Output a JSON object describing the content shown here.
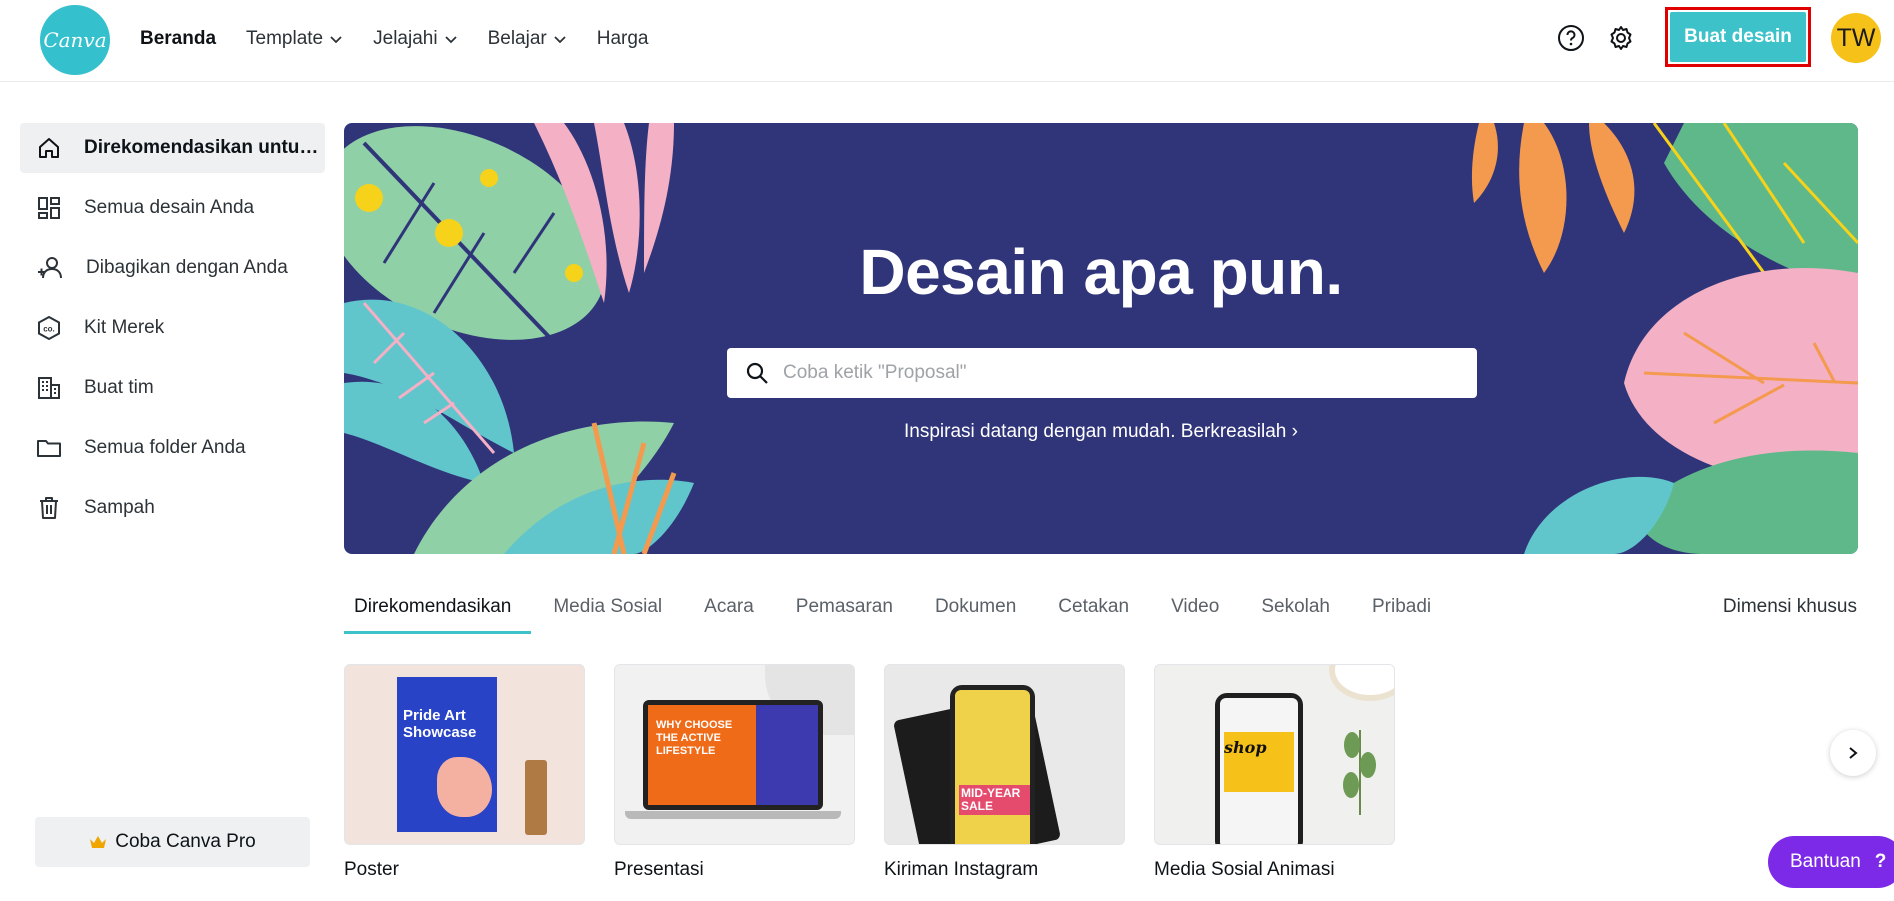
{
  "header": {
    "logo_text": "Canva",
    "nav": [
      {
        "label": "Beranda",
        "dropdown": false,
        "active": true
      },
      {
        "label": "Template",
        "dropdown": true
      },
      {
        "label": "Jelajahi",
        "dropdown": true
      },
      {
        "label": "Belajar",
        "dropdown": true
      },
      {
        "label": "Harga",
        "dropdown": false
      }
    ],
    "create_button": "Buat desain",
    "avatar_initials": "TW",
    "icons": [
      "help-icon",
      "gear-icon"
    ]
  },
  "sidebar": {
    "items": [
      {
        "label": "Direkomendasikan untuk Anda",
        "icon": "home-icon",
        "active": true
      },
      {
        "label": "Semua desain Anda",
        "icon": "grid-icon"
      },
      {
        "label": "Dibagikan dengan Anda",
        "icon": "share-people-icon"
      },
      {
        "label": "Kit Merek",
        "icon": "brand-kit-icon"
      },
      {
        "label": "Buat tim",
        "icon": "building-icon"
      },
      {
        "label": "Semua folder Anda",
        "icon": "folder-icon"
      },
      {
        "label": "Sampah",
        "icon": "trash-icon"
      }
    ],
    "pro_button": "Coba Canva Pro"
  },
  "hero": {
    "title": "Desain apa pun.",
    "search_placeholder": "Coba ketik \"Proposal\"",
    "link": "Inspirasi datang dengan mudah. Berkreasilah ›"
  },
  "tabs": {
    "items": [
      "Direkomendasikan",
      "Media Sosial",
      "Acara",
      "Pemasaran",
      "Dokumen",
      "Cetakan",
      "Video",
      "Sekolah",
      "Pribadi"
    ],
    "active": "Direkomendasikan",
    "custom_dimensions": "Dimensi khusus"
  },
  "cards": [
    {
      "label": "Poster",
      "thumb_text_1": "Pride Art",
      "thumb_text_2": "Showcase"
    },
    {
      "label": "Presentasi",
      "thumb_text": "WHY CHOOSE THE ACTIVE LIFESTYLE"
    },
    {
      "label": "Kiriman Instagram",
      "thumb_text": "MID-YEAR SALE"
    },
    {
      "label": "Media Sosial Animasi",
      "thumb_text": "shop"
    }
  ],
  "help_pill": "Bantuan",
  "colors": {
    "teal": "#3dc2c9",
    "hero_bg": "#30357a",
    "purple": "#7d2ae8",
    "avatar": "#f6c21a"
  }
}
